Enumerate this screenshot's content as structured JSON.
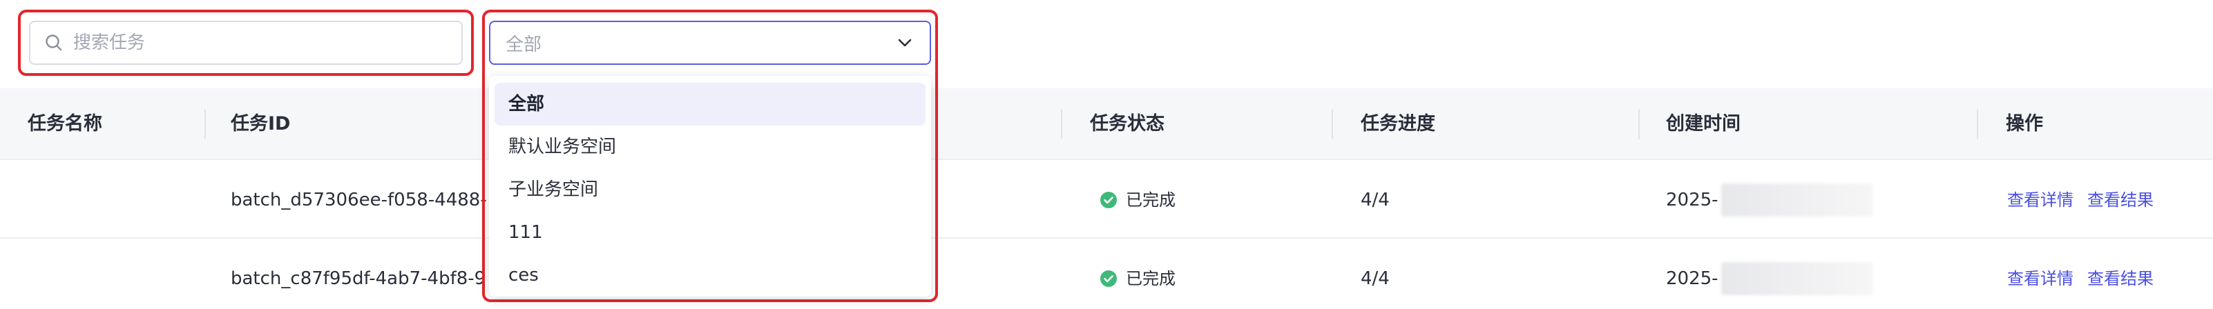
{
  "search": {
    "placeholder": "搜索任务",
    "value": ""
  },
  "filter": {
    "selected_label": "全部",
    "options": [
      "全部",
      "默认业务空间",
      "子业务空间",
      "111",
      "ces"
    ]
  },
  "table": {
    "columns": [
      "任务名称",
      "任务ID",
      "任务状态",
      "任务进度",
      "创建时间",
      "操作"
    ],
    "rows": [
      {
        "name": "",
        "id": "batch_d57306ee-f058-4488-",
        "status": "已完成",
        "progress": "4/4",
        "created": "2025-",
        "actions": [
          "查看详情",
          "查看结果"
        ]
      },
      {
        "name": "",
        "id": "batch_c87f95df-4ab7-4bf8-9",
        "status": "已完成",
        "progress": "4/4",
        "created": "2025-",
        "actions": [
          "查看详情",
          "查看结果"
        ]
      }
    ]
  },
  "colors": {
    "accent": "#5b5ce0",
    "link": "#4a4fe0",
    "success": "#3eb97a",
    "highlight_border": "#e3262c"
  }
}
